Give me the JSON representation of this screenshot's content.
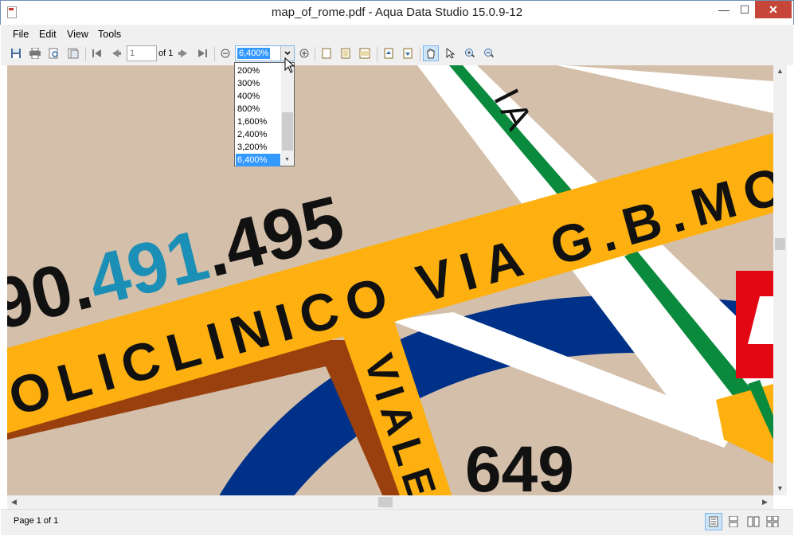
{
  "window": {
    "title": "map_of_rome.pdf - Aqua Data Studio 15.0.9-12",
    "minimize": "—",
    "maximize": "☐",
    "close": "✕"
  },
  "menu": {
    "items": [
      "File",
      "Edit",
      "View",
      "Tools"
    ]
  },
  "toolbar": {
    "page_number": "1",
    "page_of": "of 1",
    "zoom_value": "6,400%",
    "icons": [
      "save-icon",
      "print-icon",
      "print-preview-icon",
      "page-setup-icon",
      "first-page-icon",
      "previous-page-icon",
      "next-page-icon",
      "last-page-icon",
      "zoom-out-icon",
      "zoom-in-icon",
      "single-page-icon",
      "fit-page-icon",
      "fit-width-icon",
      "rotate-left-icon",
      "rotate-right-icon",
      "hand-tool-icon",
      "select-tool-icon",
      "zoom-tool-in-icon",
      "zoom-tool-out-icon"
    ]
  },
  "zoom_dropdown": {
    "options": [
      "200%",
      "300%",
      "400%",
      "800%",
      "1,600%",
      "2,400%",
      "3,200%",
      "6,400%"
    ],
    "selected": "6,400%"
  },
  "map": {
    "phone_part1": "90.",
    "phone_part2": "491",
    "phone_part3": ".495",
    "street_1": "OLICLINICO VIA G.B.MORGA",
    "street_2": "VIALE",
    "street_top": "IA",
    "number_649": "649",
    "colors": {
      "background": "#d4bfaa",
      "yellow_road": "#fdb00f",
      "brown_road": "#9a400e",
      "blue_road": "#003189",
      "green_line": "#0a8a3c",
      "teal_text": "#1b8fb5",
      "red_sign": "#e30613"
    }
  },
  "status": {
    "text": "Page 1 of 1",
    "view_modes": [
      "single-page-view-icon",
      "continuous-view-icon",
      "facing-view-icon",
      "continuous-facing-view-icon"
    ]
  },
  "accent": "#3399ff"
}
